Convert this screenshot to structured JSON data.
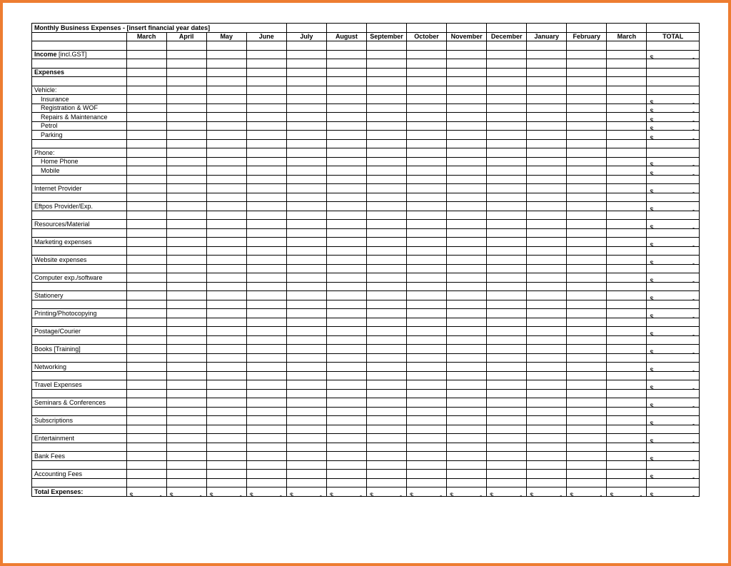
{
  "title": "Monthly Business Expenses - [insert financial year dates]",
  "months": [
    "March",
    "April",
    "May",
    "June",
    "July",
    "August",
    "September",
    "October",
    "November",
    "December",
    "January",
    "February",
    "March"
  ],
  "totalHeader": "TOTAL",
  "dollar": "$",
  "dash": "-",
  "rows": [
    {
      "type": "blank"
    },
    {
      "type": "line",
      "label": "Income",
      "suffix": " [incl.GST]",
      "bold": true,
      "hasTotal": true
    },
    {
      "type": "blank"
    },
    {
      "type": "line",
      "label": "Expenses",
      "bold": true,
      "hasTotal": false
    },
    {
      "type": "blank"
    },
    {
      "type": "line",
      "label": "Vehicle:",
      "hasTotal": false
    },
    {
      "type": "line",
      "label": "Insurance",
      "indent": true,
      "hasTotal": true
    },
    {
      "type": "line",
      "label": "Registration & WOF",
      "indent": true,
      "hasTotal": true
    },
    {
      "type": "line",
      "label": "Repairs & Maintenance",
      "indent": true,
      "hasTotal": true
    },
    {
      "type": "line",
      "label": "Petrol",
      "indent": true,
      "hasTotal": true
    },
    {
      "type": "line",
      "label": "Parking",
      "indent": true,
      "hasTotal": true
    },
    {
      "type": "blank"
    },
    {
      "type": "line",
      "label": "Phone:",
      "hasTotal": false
    },
    {
      "type": "line",
      "label": "Home Phone",
      "indent": true,
      "hasTotal": true
    },
    {
      "type": "line",
      "label": "Mobile",
      "indent": true,
      "hasTotal": true
    },
    {
      "type": "blank"
    },
    {
      "type": "line",
      "label": "Internet Provider",
      "hasTotal": true
    },
    {
      "type": "blank"
    },
    {
      "type": "line",
      "label": "Eftpos Provider/Exp.",
      "hasTotal": true
    },
    {
      "type": "blank"
    },
    {
      "type": "line",
      "label": "Resources/Material",
      "hasTotal": true
    },
    {
      "type": "blank"
    },
    {
      "type": "line",
      "label": "Marketing expenses",
      "hasTotal": true
    },
    {
      "type": "blank"
    },
    {
      "type": "line",
      "label": "Website expenses",
      "hasTotal": true
    },
    {
      "type": "blank"
    },
    {
      "type": "line",
      "label": "Computer exp./software",
      "hasTotal": true
    },
    {
      "type": "blank"
    },
    {
      "type": "line",
      "label": "Stationery",
      "hasTotal": true
    },
    {
      "type": "blank"
    },
    {
      "type": "line",
      "label": "Printing/Photocopying",
      "hasTotal": true
    },
    {
      "type": "blank"
    },
    {
      "type": "line",
      "label": "Postage/Courier",
      "hasTotal": true
    },
    {
      "type": "blank"
    },
    {
      "type": "line",
      "label": "Books [Training]",
      "hasTotal": true
    },
    {
      "type": "blank"
    },
    {
      "type": "line",
      "label": "Networking",
      "hasTotal": true
    },
    {
      "type": "blank"
    },
    {
      "type": "line",
      "label": "Travel Expenses",
      "hasTotal": true
    },
    {
      "type": "blank"
    },
    {
      "type": "line",
      "label": "Seminars & Conferences",
      "hasTotal": true
    },
    {
      "type": "blank"
    },
    {
      "type": "line",
      "label": "Subscriptions",
      "hasTotal": true
    },
    {
      "type": "blank"
    },
    {
      "type": "line",
      "label": "Entertainment",
      "hasTotal": true
    },
    {
      "type": "blank"
    },
    {
      "type": "line",
      "label": "Bank Fees",
      "hasTotal": true
    },
    {
      "type": "blank"
    },
    {
      "type": "line",
      "label": "Accounting Fees",
      "hasTotal": true
    },
    {
      "type": "blank"
    },
    {
      "type": "totals",
      "label": "Total Expenses:",
      "bold": true
    }
  ]
}
